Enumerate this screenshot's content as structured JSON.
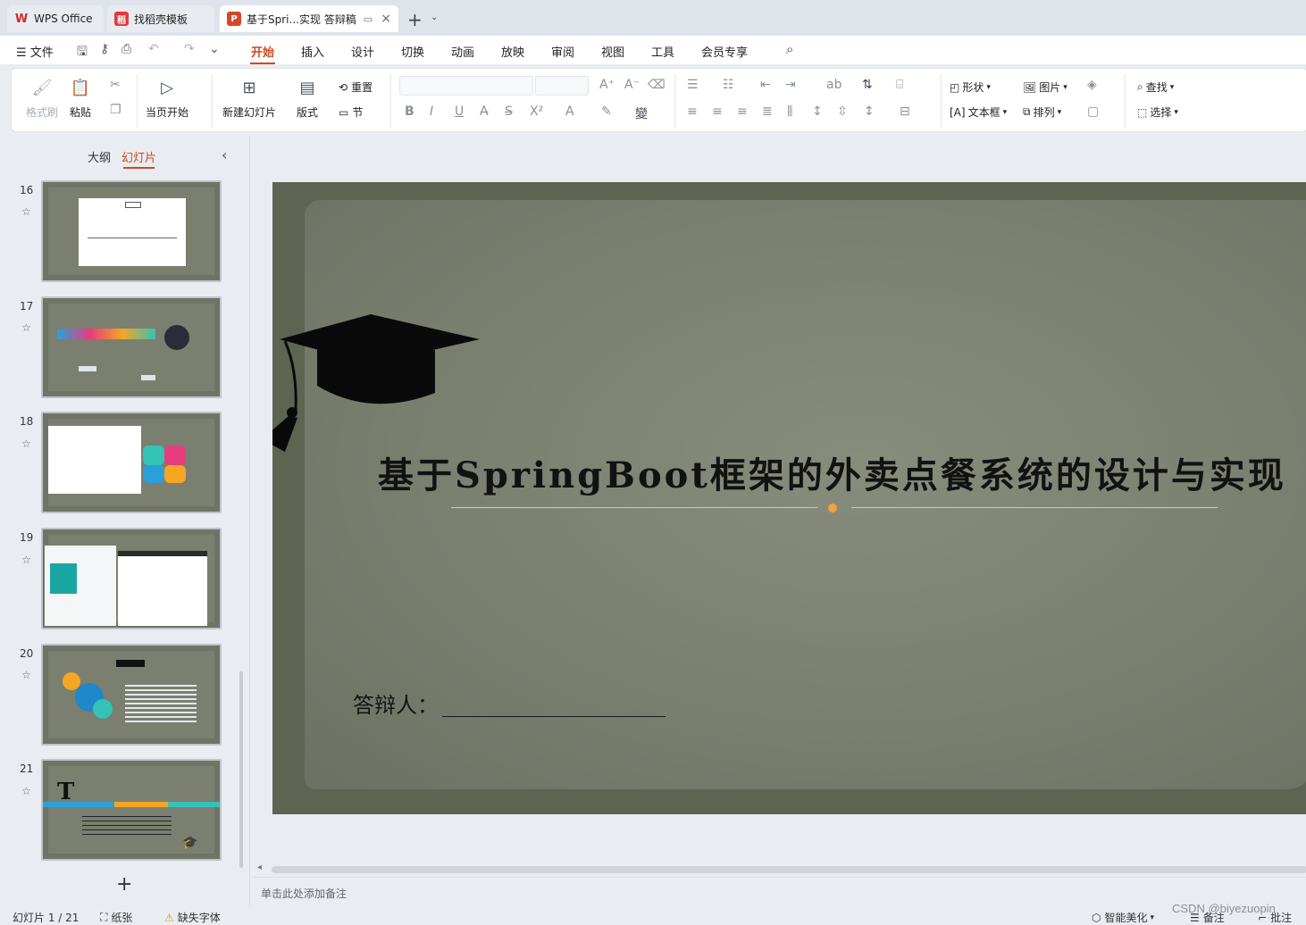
{
  "tabs": {
    "wps": "WPS Office",
    "template": "找稻壳模板",
    "document": "基于Spri...实现 答辩稿"
  },
  "menu": {
    "file": "文件",
    "items": [
      "开始",
      "插入",
      "设计",
      "切换",
      "动画",
      "放映",
      "审阅",
      "视图",
      "工具",
      "会员专享"
    ]
  },
  "ribbon": {
    "format_painter": "格式刷",
    "paste": "粘贴",
    "start_from_current": "当页开始",
    "new_slide": "新建幻灯片",
    "layout": "版式",
    "reset": "重置",
    "section": "节",
    "shape": "形状",
    "picture": "图片",
    "textbox": "文本框",
    "arrange": "排列",
    "find": "查找",
    "select": "选择"
  },
  "panel": {
    "outline_tab": "大纲",
    "slides_tab": "幻灯片",
    "slide_numbers": [
      "16",
      "17",
      "18",
      "19",
      "20",
      "21"
    ]
  },
  "slide": {
    "title": "基于SpringBoot框架的外卖点餐系统的设计与实现",
    "defense_label": "答辩人："
  },
  "notes": {
    "placeholder": "单击此处添加备注"
  },
  "status": {
    "slide_count": "幻灯片 1 / 21",
    "paper": "纸张",
    "missing_fonts": "缺失字体",
    "smart_beautify": "智能美化",
    "notes": "备注",
    "comments": "批注"
  },
  "watermark": "CSDN @biyezuopin",
  "colors": {
    "accent": "#d0491f",
    "slide_bg": "#7b7f70",
    "title_dot": "#f0a33a"
  }
}
